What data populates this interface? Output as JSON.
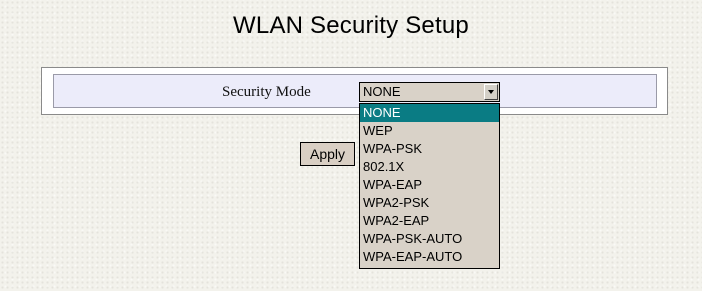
{
  "page": {
    "title": "WLAN Security Setup"
  },
  "form": {
    "security_mode_label": "Security Mode",
    "security_mode_value": "NONE",
    "apply_label": "Apply"
  },
  "dropdown": {
    "options": [
      "NONE",
      "WEP",
      "WPA-PSK",
      "802.1X",
      "WPA-EAP",
      "WPA2-PSK",
      "WPA2-EAP",
      "WPA-PSK-AUTO",
      "WPA-EAP-AUTO"
    ],
    "highlighted_index": 0
  },
  "colors": {
    "highlight": "#0a7c84",
    "row_background": "#ececfa",
    "control_background": "#d9d2c8"
  },
  "icons": {
    "select_arrow": "chevron-down-icon"
  }
}
